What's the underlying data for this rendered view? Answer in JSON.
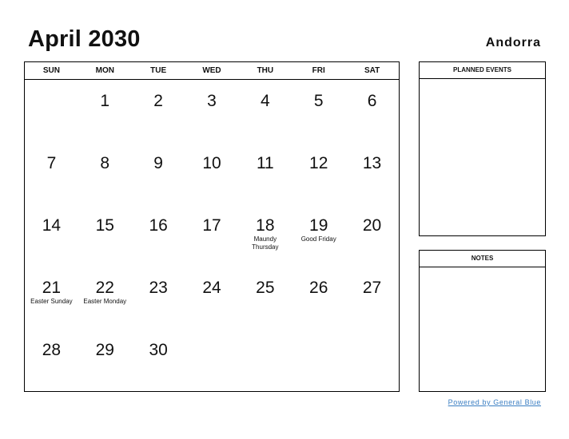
{
  "header": {
    "title": "April 2030",
    "country": "Andorra"
  },
  "weekdays": [
    "SUN",
    "MON",
    "TUE",
    "WED",
    "THU",
    "FRI",
    "SAT"
  ],
  "weeks": [
    [
      {
        "day": ""
      },
      {
        "day": "1"
      },
      {
        "day": "2"
      },
      {
        "day": "3"
      },
      {
        "day": "4"
      },
      {
        "day": "5"
      },
      {
        "day": "6"
      }
    ],
    [
      {
        "day": "7"
      },
      {
        "day": "8"
      },
      {
        "day": "9"
      },
      {
        "day": "10"
      },
      {
        "day": "11"
      },
      {
        "day": "12"
      },
      {
        "day": "13"
      }
    ],
    [
      {
        "day": "14"
      },
      {
        "day": "15"
      },
      {
        "day": "16"
      },
      {
        "day": "17"
      },
      {
        "day": "18",
        "holiday": "Maundy Thursday"
      },
      {
        "day": "19",
        "holiday": "Good Friday"
      },
      {
        "day": "20"
      }
    ],
    [
      {
        "day": "21",
        "holiday": "Easter Sunday"
      },
      {
        "day": "22",
        "holiday": "Easter Monday"
      },
      {
        "day": "23"
      },
      {
        "day": "24"
      },
      {
        "day": "25"
      },
      {
        "day": "26"
      },
      {
        "day": "27"
      }
    ],
    [
      {
        "day": "28"
      },
      {
        "day": "29"
      },
      {
        "day": "30"
      },
      {
        "day": ""
      },
      {
        "day": ""
      },
      {
        "day": ""
      },
      {
        "day": ""
      }
    ]
  ],
  "panels": {
    "planned_events": "PLANNED EVENTS",
    "notes": "NOTES"
  },
  "footer": {
    "link_text": "Powered by General Blue",
    "link_color": "#3a7ec2"
  }
}
